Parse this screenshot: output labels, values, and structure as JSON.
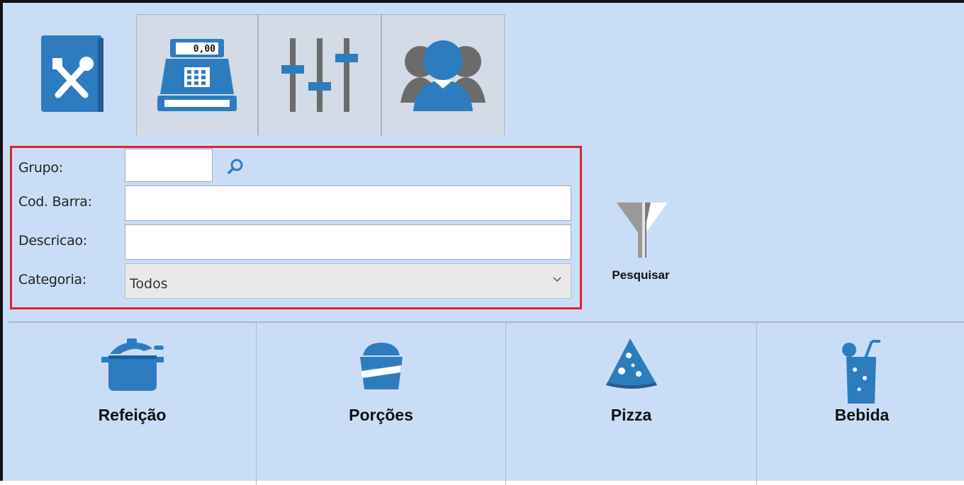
{
  "tabs": [
    {
      "icon": "menu-book-icon",
      "active": true
    },
    {
      "icon": "cash-register-icon",
      "display": "0,00",
      "active": false
    },
    {
      "icon": "settings-sliders-icon",
      "active": false
    },
    {
      "icon": "users-icon",
      "active": false
    }
  ],
  "filters": {
    "grupo_label": "Grupo:",
    "grupo_value": "",
    "cod_barra_label": "Cod. Barra:",
    "cod_barra_value": "",
    "descricao_label": "Descricao:",
    "descricao_value": "",
    "categoria_label": "Categoria:",
    "categoria_value": "Todos"
  },
  "search_button": {
    "label": "Pesquisar",
    "icon": "filter-icon"
  },
  "categories": [
    {
      "name": "Refeição",
      "icon": "pot-icon"
    },
    {
      "name": "Porções",
      "icon": "food-bowl-icon"
    },
    {
      "name": "Pizza",
      "icon": "pizza-slice-icon"
    },
    {
      "name": "Bebida",
      "icon": "drink-glass-icon"
    }
  ],
  "colors": {
    "accent": "#2e7cc0",
    "background": "#c9def6",
    "highlight": "#e02228"
  }
}
